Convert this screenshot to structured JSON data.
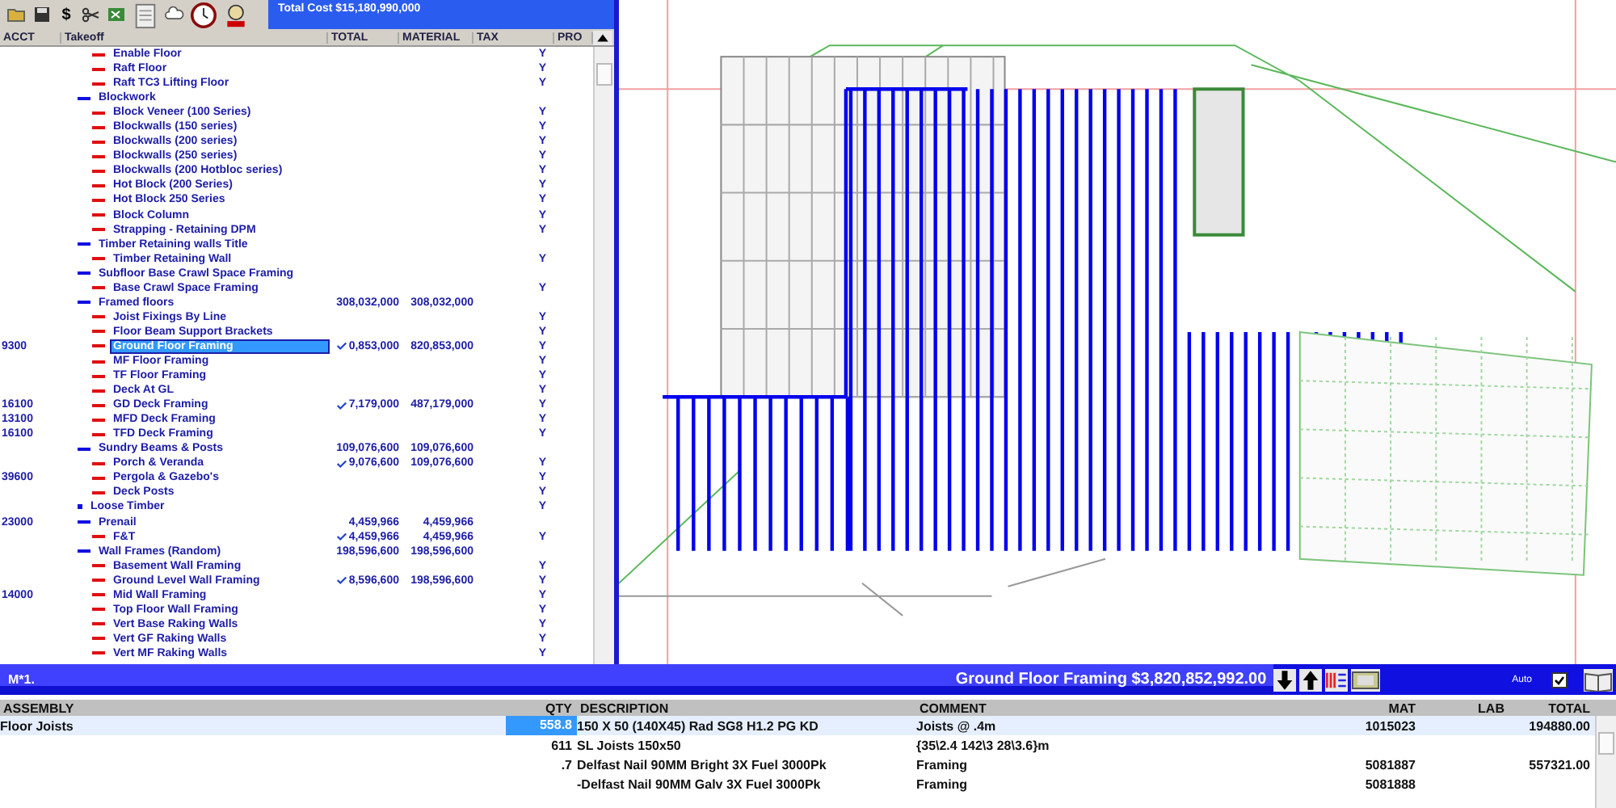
{
  "toolbar": {
    "glyphs": [
      "$"
    ],
    "total_cost": "Total Cost  $15,180,990,000"
  },
  "takeoff": {
    "columns": [
      "ACCT",
      "Takeoff",
      "TOTAL",
      "MATERIAL",
      "TAX",
      "PRO"
    ],
    "rows": [
      {
        "kind": "item",
        "label": "Enable Floor",
        "tax": "Y",
        "checked": false,
        "selected": false
      },
      {
        "kind": "item",
        "label": "Raft Floor",
        "tax": "Y",
        "checked": false,
        "selected": false
      },
      {
        "kind": "item",
        "label": "Raft TC3 Lifting Floor",
        "tax": "Y",
        "checked": false,
        "selected": false
      },
      {
        "kind": "group",
        "label": "Blockwork",
        "checked": false,
        "selected": false,
        "children": [
          {
            "kind": "item",
            "label": "Block Veneer (100 Series)",
            "tax": "Y",
            "checked": false,
            "selected": false
          },
          {
            "kind": "item",
            "label": "Blockwalls (150 series)",
            "tax": "Y",
            "checked": false,
            "selected": false
          },
          {
            "kind": "item",
            "label": "Blockwalls (200 series)",
            "tax": "Y",
            "checked": false,
            "selected": false
          },
          {
            "kind": "item",
            "label": "Blockwalls (250 series)",
            "tax": "Y",
            "checked": false,
            "selected": false
          },
          {
            "kind": "item",
            "label": "Blockwalls (200 Hotbloc series)",
            "tax": "Y",
            "checked": false,
            "selected": false
          },
          {
            "kind": "item",
            "label": "Hot Block (200 Series)",
            "tax": "Y",
            "checked": false,
            "selected": false
          },
          {
            "kind": "item",
            "label": "Hot Block 250 Series",
            "tax": "Y",
            "checked": false,
            "selected": false
          },
          {
            "kind": "item",
            "label": "Block Column",
            "tax": "Y",
            "checked": false,
            "selected": false
          },
          {
            "kind": "item",
            "label": "Strapping - Retaining DPM",
            "tax": "Y",
            "checked": false,
            "selected": false
          }
        ]
      },
      {
        "kind": "group",
        "label": "Timber Retaining walls Title",
        "checked": false,
        "selected": false,
        "children": [
          {
            "kind": "item",
            "label": "Timber Retaining Wall",
            "tax": "Y",
            "checked": false,
            "selected": false
          }
        ]
      },
      {
        "kind": "group",
        "label": "Subfloor Base Crawl Space Framing",
        "checked": false,
        "selected": false,
        "children": [
          {
            "kind": "item",
            "label": "Base Crawl Space Framing",
            "tax": "Y",
            "checked": false,
            "selected": false
          }
        ]
      },
      {
        "kind": "group",
        "label": "Framed floors",
        "total": "308,032,000",
        "material": "308,032,000",
        "checked": false,
        "selected": false,
        "children": [
          {
            "kind": "item",
            "label": "Joist Fixings By Line",
            "tax": "Y",
            "checked": false,
            "selected": false
          },
          {
            "kind": "item",
            "label": "Floor Beam Support Brackets",
            "tax": "Y",
            "checked": false,
            "selected": false
          },
          {
            "kind": "item",
            "acct": "9300",
            "label": "Ground Floor Framing",
            "total": "0,853,000",
            "material": "820,853,000",
            "tax": "Y",
            "checked": true,
            "selected": true
          },
          {
            "kind": "item",
            "label": "MF Floor Framing",
            "tax": "Y",
            "checked": false,
            "selected": false
          },
          {
            "kind": "item",
            "label": "TF Floor Framing",
            "tax": "Y",
            "checked": false,
            "selected": false
          },
          {
            "kind": "item",
            "label": "Deck At GL",
            "tax": "Y",
            "checked": false,
            "selected": false
          },
          {
            "kind": "item",
            "acct": "16100",
            "label": "GD Deck Framing",
            "total": "7,179,000",
            "material": "487,179,000",
            "tax": "Y",
            "checked": true,
            "selected": false
          },
          {
            "kind": "item",
            "acct": "13100",
            "label": "MFD Deck Framing",
            "tax": "Y",
            "checked": false,
            "selected": false
          },
          {
            "kind": "item",
            "acct": "16100",
            "label": "TFD Deck Framing",
            "tax": "Y",
            "checked": false,
            "selected": false
          }
        ]
      },
      {
        "kind": "group",
        "label": "Sundry Beams & Posts",
        "total": "109,076,600",
        "material": "109,076,600",
        "checked": false,
        "selected": false,
        "children": [
          {
            "kind": "item",
            "label": "Porch & Veranda",
            "total": "9,076,600",
            "material": "109,076,600",
            "tax": "Y",
            "checked": true,
            "selected": false
          },
          {
            "kind": "item",
            "acct": "39600",
            "label": "Pergola & Gazebo's",
            "tax": "Y",
            "checked": false,
            "selected": false
          },
          {
            "kind": "item",
            "label": "Deck Posts",
            "tax": "Y",
            "checked": false,
            "selected": false
          }
        ]
      },
      {
        "kind": "leaf",
        "label": "Loose Timber",
        "tax": "Y",
        "checked": false,
        "selected": false
      },
      {
        "kind": "group",
        "acct": "23000",
        "label": "Prenail",
        "total": "4,459,966",
        "material": "4,459,966",
        "checked": false,
        "selected": false,
        "children": [
          {
            "kind": "item",
            "label": "F&T",
            "total": "4,459,966",
            "material": "4,459,966",
            "tax": "Y",
            "checked": true,
            "selected": false
          }
        ]
      },
      {
        "kind": "group",
        "label": "Wall Frames (Random)",
        "total": "198,596,600",
        "material": "198,596,600",
        "checked": false,
        "selected": false,
        "children": [
          {
            "kind": "item",
            "label": "Basement Wall Framing",
            "tax": "Y",
            "checked": false,
            "selected": false
          },
          {
            "kind": "item",
            "label": "Ground Level Wall Framing",
            "total": "8,596,600",
            "material": "198,596,600",
            "tax": "Y",
            "checked": true,
            "selected": false
          },
          {
            "kind": "item",
            "acct": "14000",
            "label": "Mid Wall Framing",
            "tax": "Y",
            "checked": false,
            "selected": false
          },
          {
            "kind": "item",
            "label": "Top Floor Wall Framing",
            "tax": "Y",
            "checked": false,
            "selected": false
          },
          {
            "kind": "item",
            "label": "Vert Base Raking Walls",
            "tax": "Y",
            "checked": false,
            "selected": false
          },
          {
            "kind": "item",
            "label": "Vert GF Raking Walls",
            "tax": "Y",
            "checked": false,
            "selected": false
          },
          {
            "kind": "item",
            "label": "Vert MF Raking Walls",
            "tax": "Y",
            "checked": false,
            "selected": false
          }
        ]
      }
    ]
  },
  "assembly_panel": {
    "title": "M*1.",
    "summary": "Ground Floor Framing $3,820,852,992.00",
    "auto_label": "Auto",
    "auto_checked": true,
    "columns": [
      "ASSEMBLY",
      "QTY",
      "DESCRIPTION",
      "COMMENT",
      "MAT",
      "LAB",
      "TOTAL"
    ],
    "rows": [
      {
        "assembly": "Floor Joists",
        "qty": "558.8",
        "description": "150 X 50 (140X45) Rad SG8 H1.2 PG KD",
        "comment": "Joists @ .4m",
        "mat": "1015023",
        "total": "194880.00",
        "selected": true
      },
      {
        "qty": "611",
        "description": "SL Joists 150x50",
        "comment": "{35\\2.4 142\\3 28\\3.6}m",
        "selected": false
      },
      {
        "qty": ".7",
        "description": "Delfast Nail 90MM Bright 3X Fuel 3000Pk",
        "comment": "Framing",
        "mat": "5081887",
        "total": "557321.00",
        "selected": false
      },
      {
        "description": "-Delfast Nail 90MM Galv 3X Fuel 3000Pk",
        "comment": "Framing",
        "mat": "5081888",
        "selected": false
      }
    ]
  }
}
